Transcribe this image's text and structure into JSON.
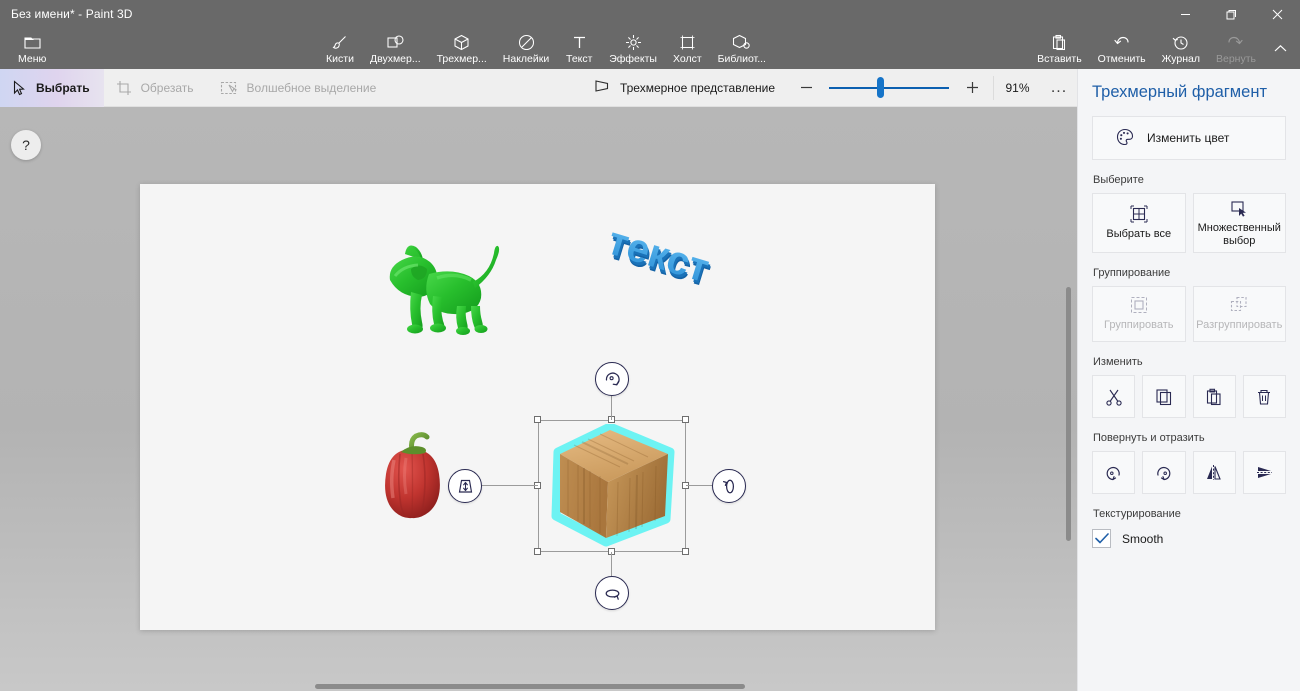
{
  "window": {
    "title": "Без имени* - Paint 3D",
    "controls": [
      {
        "name": "minimize",
        "glyph": "minimize-icon"
      },
      {
        "name": "restore",
        "glyph": "restore-icon"
      },
      {
        "name": "close",
        "glyph": "close-icon"
      }
    ]
  },
  "ribbon": {
    "menu": {
      "label": "Меню",
      "icon": "folder-icon"
    },
    "tools": [
      {
        "label": "Кисти",
        "icon": "brush-icon",
        "disabled": false
      },
      {
        "label": "Двухмер...",
        "icon": "shapes-2d-icon",
        "disabled": false
      },
      {
        "label": "Трехмер...",
        "icon": "cube-3d-icon",
        "disabled": false
      },
      {
        "label": "Наклейки",
        "icon": "stickers-icon",
        "disabled": false
      },
      {
        "label": "Текст",
        "icon": "text-icon",
        "disabled": false
      },
      {
        "label": "Эффекты",
        "icon": "effects-icon",
        "disabled": false
      },
      {
        "label": "Холст",
        "icon": "canvas-icon",
        "disabled": false
      },
      {
        "label": "Библиот...",
        "icon": "library-icon",
        "disabled": false
      }
    ],
    "actions": [
      {
        "label": "Вставить",
        "icon": "paste-icon",
        "disabled": false
      },
      {
        "label": "Отменить",
        "icon": "undo-icon",
        "disabled": false
      },
      {
        "label": "Журнал",
        "icon": "history-icon",
        "disabled": false
      },
      {
        "label": "Вернуть",
        "icon": "redo-icon",
        "disabled": true
      }
    ],
    "collapse": {
      "name": "collapse-ribbon",
      "icon": "chevron-up-icon"
    }
  },
  "subbar": {
    "tools": [
      {
        "label": "Выбрать",
        "icon": "cursor-select-icon",
        "active": true,
        "disabled": false
      },
      {
        "label": "Обрезать",
        "icon": "crop-icon",
        "active": false,
        "disabled": true
      },
      {
        "label": "Волшебное выделение",
        "icon": "magic-select-icon",
        "active": false,
        "disabled": true
      }
    ],
    "view_mode": {
      "label": "Трехмерное представление",
      "icon": "perspective-icon"
    },
    "zoom": {
      "minus": "zoom-out-icon",
      "plus": "zoom-in-icon",
      "percent": "91%",
      "slider_value": 40
    },
    "more": {
      "label": "...",
      "name": "more-options-button"
    }
  },
  "workspace": {
    "help": {
      "label": "?",
      "name": "help-button"
    },
    "objects": [
      {
        "name": "cat-3d-model",
        "label": "3D cat",
        "color": "#2eb82e"
      },
      {
        "name": "pepper-3d-model",
        "label": "3D bell pepper",
        "color": "#c0392b"
      },
      {
        "name": "text-3d-object",
        "label": "текст",
        "color": "#2f9fe0"
      },
      {
        "name": "wood-cube-3d-model",
        "label": "wooden cube",
        "color": "#c79a5b",
        "selected": true
      }
    ],
    "selection": {
      "outline_color": "#6df3f3",
      "gizmos": [
        {
          "name": "rotate-roll-gizmo",
          "position": "top"
        },
        {
          "name": "depth-move-gizmo",
          "position": "left"
        },
        {
          "name": "rotate-yaw-gizmo",
          "position": "right"
        },
        {
          "name": "rotate-pitch-gizmo",
          "position": "bottom"
        }
      ]
    },
    "scrollbars": {
      "vertical": "v-scrollbar",
      "horizontal": "h-scrollbar"
    }
  },
  "panel": {
    "title": "Трехмерный фрагмент",
    "title_color": "#1f5fa8",
    "change_color": {
      "label": "Изменить цвет",
      "icon": "palette-icon"
    },
    "select_section": {
      "label": "Выберите",
      "buttons": [
        {
          "label": "Выбрать все",
          "icon": "select-all-icon",
          "disabled": false
        },
        {
          "label": "Множественный выбор",
          "icon": "multi-select-icon",
          "disabled": false
        }
      ]
    },
    "group_section": {
      "label": "Группирование",
      "buttons": [
        {
          "label": "Группировать",
          "icon": "group-icon",
          "disabled": true
        },
        {
          "label": "Разгруппировать",
          "icon": "ungroup-icon",
          "disabled": true
        }
      ]
    },
    "edit_section": {
      "label": "Изменить",
      "buttons": [
        {
          "name": "cut-button",
          "icon": "scissors-icon"
        },
        {
          "name": "copy-button",
          "icon": "copy-icon"
        },
        {
          "name": "paste-button",
          "icon": "paste-icon"
        },
        {
          "name": "delete-button",
          "icon": "trash-icon"
        }
      ]
    },
    "rotate_section": {
      "label": "Повернуть и отразить",
      "buttons": [
        {
          "name": "rotate-left-button",
          "icon": "rotate-ccw-icon"
        },
        {
          "name": "rotate-right-button",
          "icon": "rotate-cw-icon"
        },
        {
          "name": "flip-horizontal-button",
          "icon": "flip-horizontal-icon"
        },
        {
          "name": "flip-vertical-button",
          "icon": "flip-vertical-icon"
        }
      ]
    },
    "texture_section": {
      "label": "Текстурирование",
      "checkbox": {
        "label": "Smooth",
        "checked": true
      }
    }
  }
}
